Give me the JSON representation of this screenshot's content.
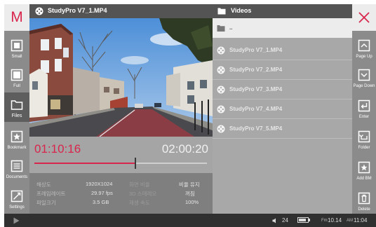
{
  "app": {
    "logo": "M",
    "accent_color": "#d8254c"
  },
  "left_sidebar": {
    "items": [
      {
        "label": "Small",
        "icon": "small-window-icon"
      },
      {
        "label": "Full",
        "icon": "fullscreen-icon"
      },
      {
        "label": "Files",
        "icon": "folder-icon",
        "active": true
      },
      {
        "label": "Bookmark",
        "icon": "bookmark-star-icon"
      },
      {
        "label": "Documents",
        "icon": "documents-icon"
      },
      {
        "label": "Settings",
        "icon": "settings-icon"
      }
    ]
  },
  "player": {
    "title": "StudyPro V7_1.MP4",
    "current_time": "01:10:16",
    "total_time": "02:00:20",
    "progress": 0.585,
    "info": {
      "resolution_label": "해상도",
      "resolution_value": "1920X1024",
      "framerate_label": "프레임레이트",
      "framerate_value": "29.97 fps",
      "filesize_label": "파일크기",
      "filesize_value": "3.5 GB",
      "screen_ratio_label": "화면 비율",
      "screen_ratio_value": "비율 유지",
      "mode_3d_label": "3D 스테레오",
      "mode_3d_value": "꺼짐",
      "speed_label": "재생 속도",
      "speed_value": "100%"
    }
  },
  "file_browser": {
    "title": "Videos",
    "items": [
      {
        "name": "..",
        "type": "parent-folder",
        "selected": true
      },
      {
        "name": "StudyPro V7_1.MP4",
        "type": "video"
      },
      {
        "name": "StudyPro V7_2.MP4",
        "type": "video"
      },
      {
        "name": "StudyPro V7_3.MP4",
        "type": "video"
      },
      {
        "name": "StudyPro V7_4.MP4",
        "type": "video"
      },
      {
        "name": "StudyPro V7_5.MP4",
        "type": "video"
      }
    ]
  },
  "right_sidebar": {
    "close_icon": "close-icon",
    "items": [
      {
        "label": "Page Up",
        "icon": "page-up-icon"
      },
      {
        "label": "Page Down",
        "icon": "page-down-icon"
      },
      {
        "label": "Enter",
        "icon": "enter-icon"
      },
      {
        "label": "Folder",
        "icon": "folder-up-icon"
      },
      {
        "label": "Add BM",
        "icon": "add-bookmark-icon"
      },
      {
        "label": "Delete",
        "icon": "trash-icon"
      }
    ]
  },
  "status_bar": {
    "volume": "24",
    "battery_level": 0.85,
    "fm_label": "Fm",
    "fm_value": "10.14",
    "am_label": "AM",
    "clock": "11:04"
  }
}
